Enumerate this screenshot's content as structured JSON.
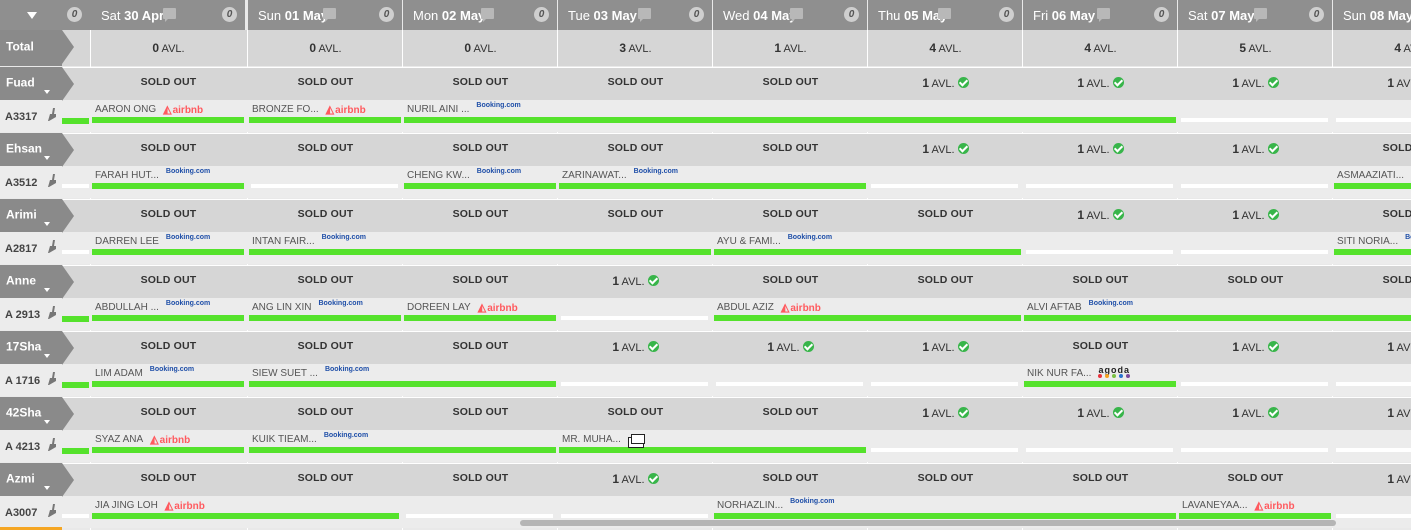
{
  "header": {
    "collapse_label": "collapse-all",
    "corner_count": "0",
    "days": [
      {
        "dow": "Sat",
        "date": "30 Apr",
        "count": "0"
      },
      {
        "dow": "Sun",
        "date": "01 May",
        "count": "0"
      },
      {
        "dow": "Mon",
        "date": "02 May",
        "count": "0"
      },
      {
        "dow": "Tue",
        "date": "03 May",
        "count": "0"
      },
      {
        "dow": "Wed",
        "date": "04 May",
        "count": "0"
      },
      {
        "dow": "Thu",
        "date": "05 May",
        "count": "0"
      },
      {
        "dow": "Fri",
        "date": "06 May",
        "count": "0"
      },
      {
        "dow": "Sat",
        "date": "07 May",
        "count": "0"
      },
      {
        "dow": "Sun",
        "date": "08 May",
        "count": ""
      }
    ]
  },
  "total": {
    "label": "Total",
    "values": [
      "0",
      "0",
      "0",
      "3",
      "1",
      "4",
      "4",
      "5",
      "4"
    ],
    "avl_label": "AVL."
  },
  "sold_out_text": "SOLD OUT",
  "avl_text": "AVL.",
  "room_types": [
    {
      "name": "Fuad",
      "room": "A3317",
      "cells": [
        "SOLD OUT",
        "SOLD OUT",
        "SOLD OUT",
        "SOLD OUT",
        "SOLD OUT",
        "1",
        "1",
        "1",
        "1"
      ],
      "bookings": [
        {
          "guest": "AARON ONG",
          "source": "airbnb"
        },
        {
          "guest": "BRONZE FO...",
          "source": "airbnb"
        },
        {
          "guest": "NURIL AINI ...",
          "source": "Booking.com"
        }
      ]
    },
    {
      "name": "Ehsan",
      "room": "A3512",
      "cells": [
        "SOLD OUT",
        "SOLD OUT",
        "SOLD OUT",
        "SOLD OUT",
        "SOLD OUT",
        "1",
        "1",
        "1",
        "SOLD OUT"
      ],
      "bookings": [
        {
          "guest": "FARAH HUT...",
          "source": "Booking.com"
        },
        {
          "guest": "CHENG KW...",
          "source": "Booking.com"
        },
        {
          "guest": "ZARINAWAT...",
          "source": "Booking.com"
        },
        {
          "guest": "ASMAAZIATI...",
          "source": ""
        }
      ]
    },
    {
      "name": "Arimi",
      "room": "A2817",
      "cells": [
        "SOLD OUT",
        "SOLD OUT",
        "SOLD OUT",
        "SOLD OUT",
        "SOLD OUT",
        "SOLD OUT",
        "1",
        "1",
        "SOLD OUT"
      ],
      "bookings": [
        {
          "guest": "DARREN LEE",
          "source": "Booking.com"
        },
        {
          "guest": "INTAN FAIR...",
          "source": "Booking.com"
        },
        {
          "guest": "AYU & FAMI...",
          "source": "Booking.com"
        },
        {
          "guest": "SITI NORIA...",
          "source": "Booking.com"
        }
      ]
    },
    {
      "name": "Anne",
      "room": "A 2913",
      "cells": [
        "SOLD OUT",
        "SOLD OUT",
        "SOLD OUT",
        "1",
        "SOLD OUT",
        "SOLD OUT",
        "SOLD OUT",
        "SOLD OUT",
        "SOLD OUT"
      ],
      "bookings": [
        {
          "guest": "ABDULLAH ...",
          "source": "Booking.com"
        },
        {
          "guest": "ANG LIN XIN",
          "source": "Booking.com"
        },
        {
          "guest": "DOREEN LAY",
          "source": "airbnb"
        },
        {
          "guest": "ABDUL AZIZ",
          "source": "airbnb"
        },
        {
          "guest": "ALVI AFTAB",
          "source": "Booking.com"
        }
      ]
    },
    {
      "name": "17Sha",
      "room": "A 1716",
      "cells": [
        "SOLD OUT",
        "SOLD OUT",
        "SOLD OUT",
        "1",
        "1",
        "1",
        "SOLD OUT",
        "1",
        "1"
      ],
      "bookings": [
        {
          "guest": "LIM ADAM",
          "source": "Booking.com"
        },
        {
          "guest": "SIEW SUET ...",
          "source": "Booking.com"
        },
        {
          "guest": "NIK NUR FA...",
          "source": "agoda"
        }
      ]
    },
    {
      "name": "42Sha",
      "room": "A 4213",
      "cells": [
        "SOLD OUT",
        "SOLD OUT",
        "SOLD OUT",
        "SOLD OUT",
        "SOLD OUT",
        "1",
        "1",
        "1",
        "1"
      ],
      "bookings": [
        {
          "guest": "SYAZ ANA",
          "source": "airbnb"
        },
        {
          "guest": "KUIK TIEAM...",
          "source": "Booking.com"
        },
        {
          "guest": "MR. MUHA...",
          "source": "cash"
        }
      ]
    },
    {
      "name": "Azmi",
      "room": "A3007",
      "cells": [
        "SOLD OUT",
        "SOLD OUT",
        "SOLD OUT",
        "1",
        "SOLD OUT",
        "SOLD OUT",
        "SOLD OUT",
        "SOLD OUT",
        "1"
      ],
      "bookings": [
        {
          "guest": "JIA JING LOH",
          "source": "airbnb"
        },
        {
          "guest": "NORHAZLIN...",
          "source": "Booking.com"
        },
        {
          "guest": "LAVANEYAA...",
          "source": "airbnb"
        }
      ]
    }
  ],
  "logos": {
    "airbnb": "airbnb",
    "booking": "Booking.com",
    "agoda": "agoda"
  },
  "colors": {
    "header_bg": "#8f8f8f",
    "booking_bar": "#55e22c",
    "available_check": "#38b54a",
    "airbnb": "#ff5a5f",
    "booking_com": "#1f4fa8"
  }
}
